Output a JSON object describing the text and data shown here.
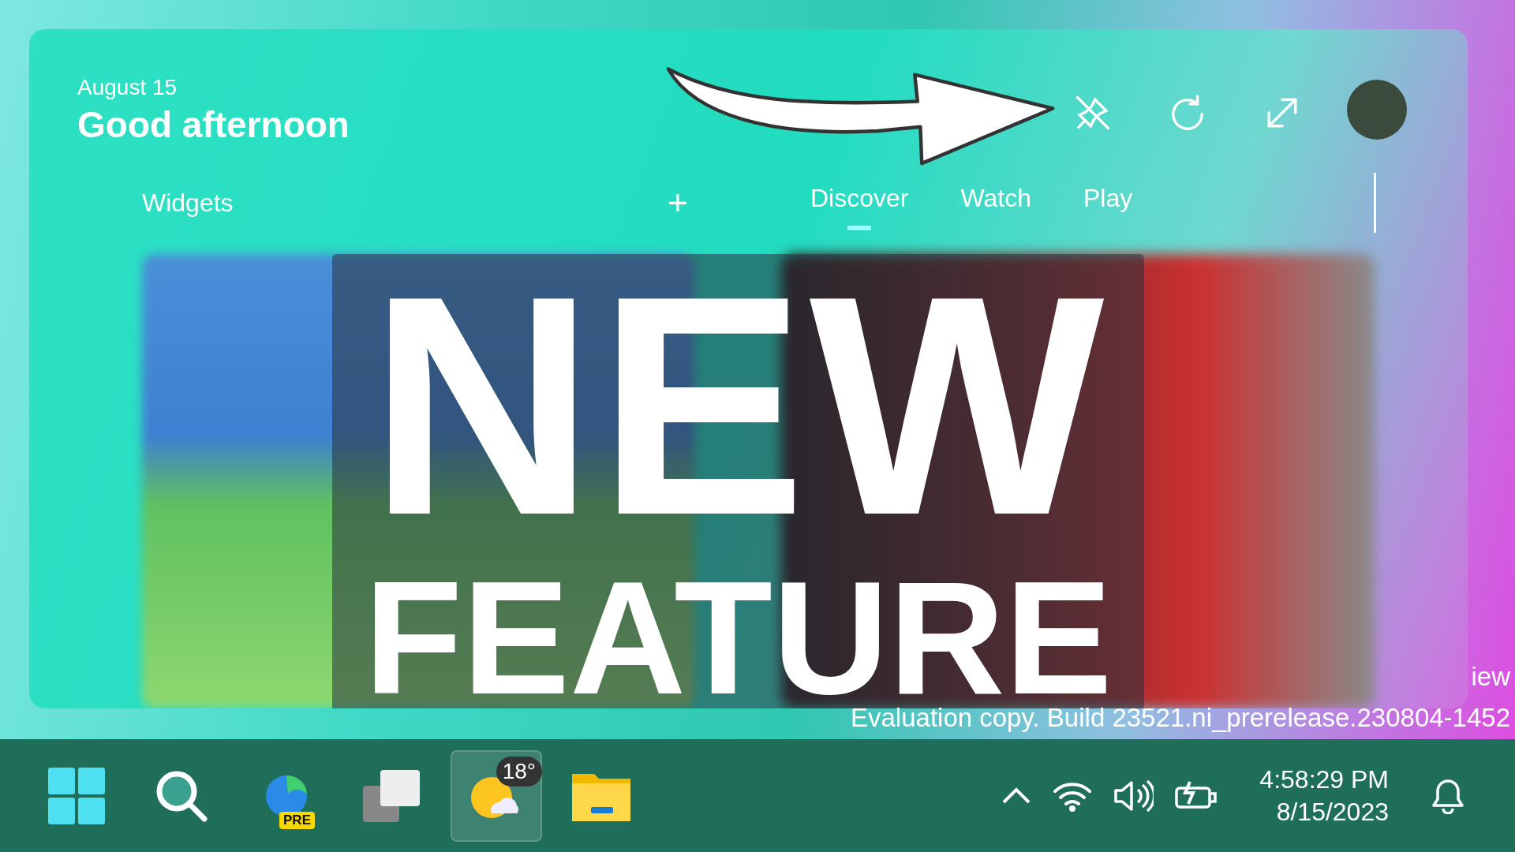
{
  "panel": {
    "date": "August 15",
    "greeting": "Good afternoon",
    "widgets_label": "Widgets",
    "add_button": "+",
    "tabs": [
      {
        "label": "Discover",
        "selected": true
      },
      {
        "label": "Watch",
        "selected": false
      },
      {
        "label": "Play",
        "selected": false
      }
    ]
  },
  "overlay": {
    "line_1": "NEW",
    "line_2": "FEATURE"
  },
  "desktop_text": {
    "partial": "iew",
    "build": "Evaluation copy. Build 23521.ni_prerelease.230804-1452"
  },
  "taskbar": {
    "apps": [
      {
        "kind": "start",
        "selected": false
      },
      {
        "kind": "search",
        "selected": false
      },
      {
        "kind": "browser",
        "badge": "PRE",
        "selected": false
      },
      {
        "kind": "taskview",
        "selected": false
      },
      {
        "kind": "weather",
        "badge": "18°",
        "selected": true
      },
      {
        "kind": "folder",
        "selected": false
      }
    ],
    "time": "4:58:29 PM",
    "date": "8/15/2023"
  }
}
